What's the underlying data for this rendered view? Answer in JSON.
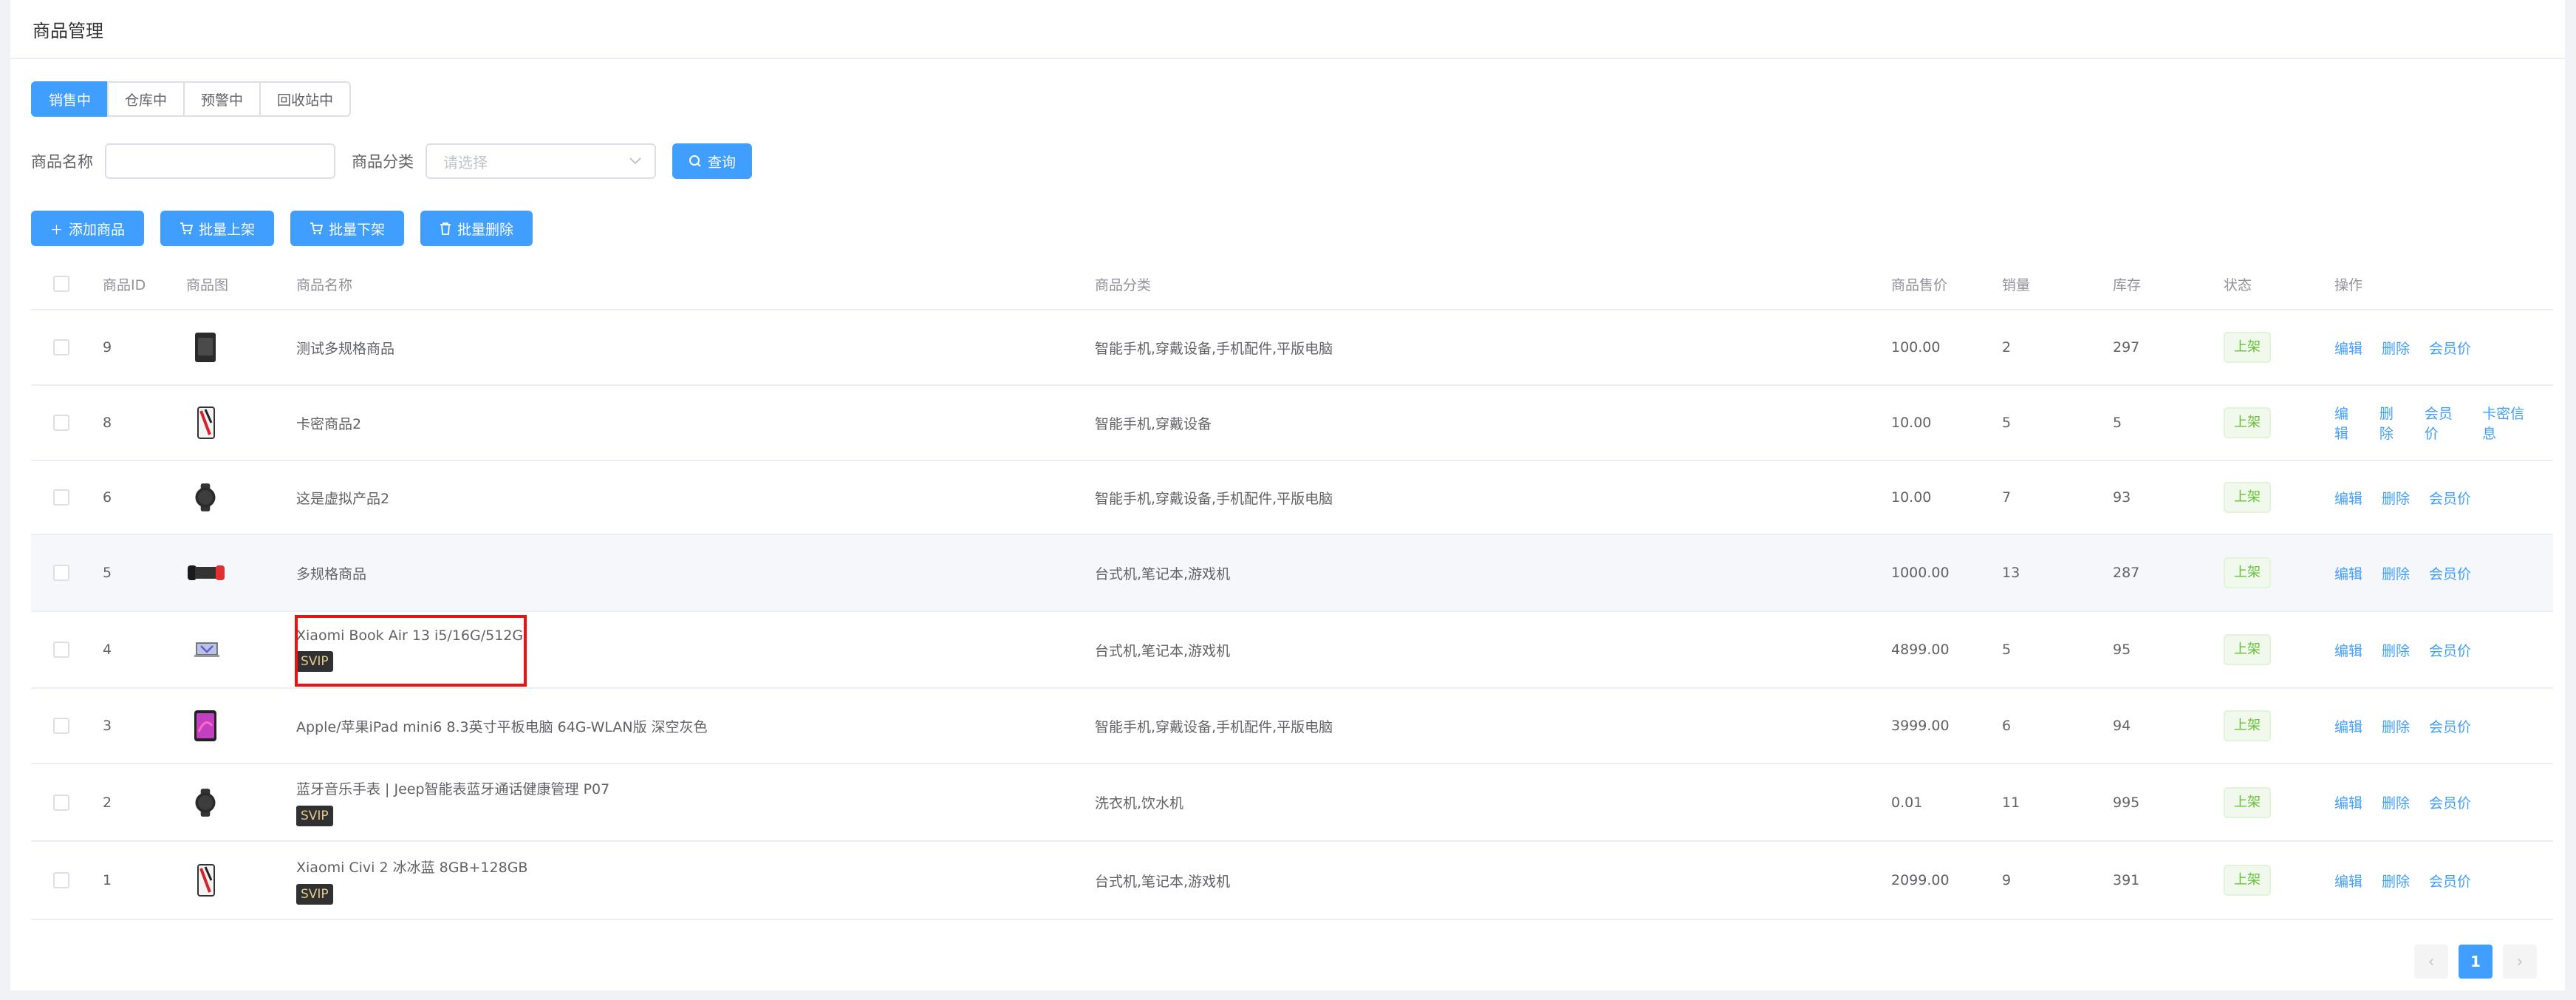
{
  "page_title": "商品管理",
  "tabs": [
    {
      "label": "销售中",
      "active": true
    },
    {
      "label": "仓库中",
      "active": false
    },
    {
      "label": "预警中",
      "active": false
    },
    {
      "label": "回收站中",
      "active": false
    }
  ],
  "search": {
    "name_label": "商品名称",
    "name_value": "",
    "category_label": "商品分类",
    "category_placeholder": "请选择",
    "query_button": "查询"
  },
  "actions": {
    "add": "添加商品",
    "batch_on": "批量上架",
    "batch_off": "批量下架",
    "batch_delete": "批量删除"
  },
  "table": {
    "headers": {
      "id": "商品ID",
      "image": "商品图",
      "name": "商品名称",
      "category": "商品分类",
      "price": "商品售价",
      "sales": "销量",
      "stock": "库存",
      "status": "状态",
      "ops": "操作"
    },
    "rows": [
      {
        "id": "9",
        "name": "测试多规格商品",
        "svip": "",
        "category": "智能手机,穿戴设备,手机配件,平版电脑",
        "price": "100.00",
        "sales": "2",
        "stock": "297",
        "status": "上架",
        "edit": "编辑",
        "delete": "删除",
        "member_price": "会员价",
        "card_info": "",
        "image_icon": "phone-dark"
      },
      {
        "id": "8",
        "name": "卡密商品2",
        "svip": "",
        "category": "智能手机,穿戴设备",
        "price": "10.00",
        "sales": "5",
        "stock": "5",
        "status": "上架",
        "edit": "编辑",
        "delete": "删除",
        "member_price": "会员价",
        "card_info": "卡密信息",
        "image_icon": "phone-red"
      },
      {
        "id": "6",
        "name": "这是虚拟产品2",
        "svip": "",
        "category": "智能手机,穿戴设备,手机配件,平版电脑",
        "price": "10.00",
        "sales": "7",
        "stock": "93",
        "status": "上架",
        "edit": "编辑",
        "delete": "删除",
        "member_price": "会员价",
        "card_info": "",
        "image_icon": "watch"
      },
      {
        "id": "5",
        "name": "多规格商品",
        "svip": "",
        "category": "台式机,笔记本,游戏机",
        "price": "1000.00",
        "sales": "13",
        "stock": "287",
        "status": "上架",
        "edit": "编辑",
        "delete": "删除",
        "member_price": "会员价",
        "card_info": "",
        "image_icon": "console"
      },
      {
        "id": "4",
        "name": "Xiaomi Book Air 13 i5/16G/512G",
        "svip": "SVIP",
        "category": "台式机,笔记本,游戏机",
        "price": "4899.00",
        "sales": "5",
        "stock": "95",
        "status": "上架",
        "edit": "编辑",
        "delete": "删除",
        "member_price": "会员价",
        "card_info": "",
        "image_icon": "laptop"
      },
      {
        "id": "3",
        "name": "Apple/苹果iPad mini6 8.3英寸平板电脑 64G-WLAN版 深空灰色",
        "svip": "",
        "category": "智能手机,穿戴设备,手机配件,平版电脑",
        "price": "3999.00",
        "sales": "6",
        "stock": "94",
        "status": "上架",
        "edit": "编辑",
        "delete": "删除",
        "member_price": "会员价",
        "card_info": "",
        "image_icon": "tablet"
      },
      {
        "id": "2",
        "name": "蓝牙音乐手表 | Jeep智能表蓝牙通话健康管理 P07",
        "svip": "SVIP",
        "category": "洗衣机,饮水机",
        "price": "0.01",
        "sales": "11",
        "stock": "995",
        "status": "上架",
        "edit": "编辑",
        "delete": "删除",
        "member_price": "会员价",
        "card_info": "",
        "image_icon": "watch"
      },
      {
        "id": "1",
        "name": "Xiaomi Civi 2 冰冰蓝 8GB+128GB",
        "svip": "SVIP",
        "category": "台式机,笔记本,游戏机",
        "price": "2099.00",
        "sales": "9",
        "stock": "391",
        "status": "上架",
        "edit": "编辑",
        "delete": "删除",
        "member_price": "会员价",
        "card_info": "",
        "image_icon": "phone-red"
      }
    ]
  },
  "pagination": {
    "prev": "‹",
    "current": "1",
    "next": "›"
  },
  "colors": {
    "primary": "#409eff",
    "success": "#67c23a",
    "highlight": "#ee1111"
  }
}
